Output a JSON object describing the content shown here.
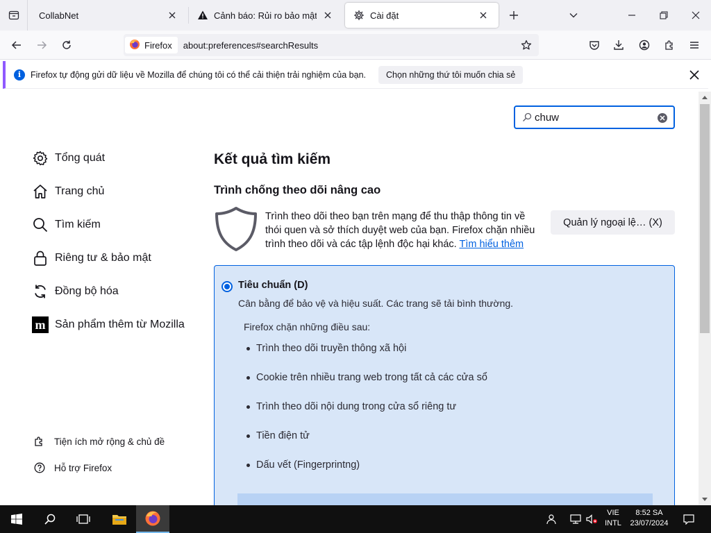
{
  "browser": {
    "tabs": [
      {
        "title": "CollabNet",
        "selected": false
      },
      {
        "title": "Cảnh báo: Rủi ro bảo mật tiềm",
        "selected": false
      },
      {
        "title": "Cài đặt",
        "selected": true
      }
    ],
    "identity_label": "Firefox",
    "url": "about:preferences#searchResults"
  },
  "notification": {
    "message": "Firefox tự động gửi dữ liệu về Mozilla để chúng tôi có thể cải thiện trải nghiệm của bạn.",
    "button": "Chọn những thứ tôi muốn chia sẻ"
  },
  "search": {
    "value": "chuw"
  },
  "sidebar": {
    "categories": [
      {
        "label": "Tổng quát",
        "icon": "gear-icon"
      },
      {
        "label": "Trang chủ",
        "icon": "home-icon"
      },
      {
        "label": "Tìm kiếm",
        "icon": "search-icon"
      },
      {
        "label": "Riêng tư & bảo mật",
        "icon": "lock-icon"
      },
      {
        "label": "Đồng bộ hóa",
        "icon": "sync-icon"
      },
      {
        "label": "Sản phẩm thêm từ Mozilla",
        "icon": "mozilla-m-icon"
      }
    ],
    "footer": [
      {
        "label": "Tiện ích mở rộng & chủ đề",
        "icon": "puzzle-icon"
      },
      {
        "label": "Hỗ trợ Firefox",
        "icon": "help-icon"
      }
    ]
  },
  "main": {
    "title": "Kết quả tìm kiếm",
    "section_title": "Trình chống theo dõi nâng cao",
    "description": "Trình theo dõi theo bạn trên mạng để thu thập thông tin về thói quen và sở thích duyệt web của bạn. Firefox chặn nhiều trình theo dõi và các tập lệnh độc hại khác.",
    "learn_more": "Tìm hiểu thêm",
    "manage_button": "Quản lý ngoại lệ… (X)",
    "standard": {
      "title": "Tiêu chuẩn (D)",
      "description": "Cân bằng để bảo vệ và hiệu suất. Các trang sẽ tải bình thường.",
      "blocks_title": "Firefox chặn những điều sau:",
      "items": [
        "Trình theo dõi truyền thông xã hội",
        "Cookie trên nhiều trang web trong tất cả các cửa sổ",
        "Trình theo dõi nội dung trong cửa sổ riêng tư",
        "Tiền điện tử",
        "Dấu vết (Fingerprintng)"
      ]
    }
  },
  "taskbar": {
    "lang_top": "VIE",
    "lang_bottom": "INTL",
    "time": "8:52 SA",
    "date": "23/07/2024"
  },
  "colors": {
    "accent": "#0061e0",
    "notification_stripe": "#9059ff",
    "panel_bg": "#d8e6f8"
  }
}
